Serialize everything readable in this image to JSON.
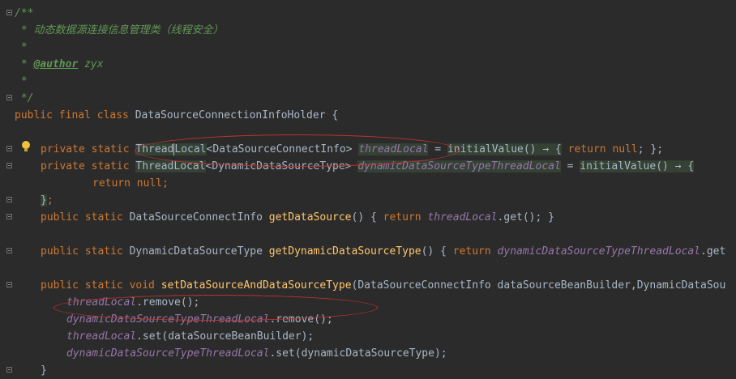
{
  "colors": {
    "background": "#2b2b2b",
    "keyword": "#cc7832",
    "comment": "#629755",
    "method": "#ffc66d",
    "field": "#9876aa",
    "text": "#a9b7c6",
    "annotation_ellipse": "#c0332b"
  },
  "icons": [
    "fold-icon",
    "lightbulb-icon"
  ],
  "code": {
    "doc_open": "/**",
    "doc_star": " * ",
    "doc_desc": "动态数据源连接信息管理类（线程安全）",
    "doc_blank": " *",
    "doc_author_tag": "@author",
    "doc_author_name": " zyx",
    "doc_close": " */",
    "l7": {
      "kw": "public final class ",
      "name": "DataSourceConnectionInfoHolder {"
    },
    "l9": {
      "kw": "private static ",
      "type_a": "Thread",
      "type_b": "Local",
      "generic": "<DataSourceConnectInfo> ",
      "field": "threadLocal",
      "eq": " = ",
      "method": "initialValue",
      "arrow": "() → {",
      "ret": "return ",
      "ret_val": "null",
      "end": "; };"
    },
    "l10": {
      "kw": "private static ",
      "type": "ThreadLocal",
      "generic": "<DynamicDataSourceType> ",
      "field": "dynamicDataSourceTypeThreadLocal",
      "eq": " = ",
      "method": "initialValue",
      "arrow": "() → {"
    },
    "l11": {
      "ret": "return ",
      "val": "null",
      "end": ";"
    },
    "l12": {
      "close": "}",
      "semi": ";"
    },
    "l13": {
      "kw": "public static ",
      "type": "DataSourceConnectInfo ",
      "method": "getDataSource",
      "open": "() { ",
      "ret": "return ",
      "field": "threadLocal",
      "call": ".get(); }"
    },
    "l15": {
      "kw": "public static ",
      "type": "DynamicDataSourceType ",
      "method": "getDynamicDataSourceType",
      "open": "() { ",
      "ret": "return ",
      "field": "dynamicDataSourceTypeThreadLocal",
      "call": ".get"
    },
    "l17": {
      "kw": "public static void ",
      "method": "setDataSourceAndDataSourceType",
      "params": "(DataSourceConnectInfo dataSourceBeanBuilder,DynamicDataSou"
    },
    "l18": {
      "field": "threadLocal",
      "call": ".remove();"
    },
    "l19": {
      "field": "dynamicDataSourceTypeThreadLocal",
      "call": ".remove();"
    },
    "l20": {
      "field": "threadLocal",
      "call": ".set(dataSourceBeanBuilder);"
    },
    "l21": {
      "field": "dynamicDataSourceTypeThreadLocal",
      "call": ".set(dynamicDataSourceType);"
    },
    "l22": {
      "close": "}"
    }
  }
}
